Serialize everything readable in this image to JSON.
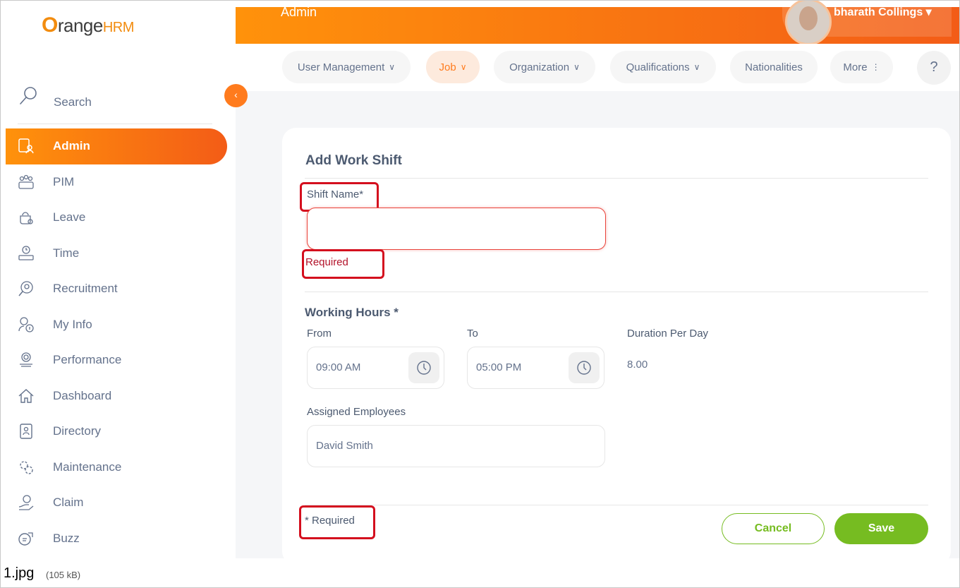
{
  "app": {
    "logo_orange": "O",
    "logo_text": "range",
    "logo_hrm": "HRM"
  },
  "sidebar": {
    "search_label": "Search",
    "items": [
      {
        "label": "Admin",
        "icon": "admin-icon"
      },
      {
        "label": "PIM",
        "icon": "pim-icon"
      },
      {
        "label": "Leave",
        "icon": "leave-icon"
      },
      {
        "label": "Time",
        "icon": "time-icon"
      },
      {
        "label": "Recruitment",
        "icon": "recruitment-icon"
      },
      {
        "label": "My Info",
        "icon": "my-info-icon"
      },
      {
        "label": "Performance",
        "icon": "performance-icon"
      },
      {
        "label": "Dashboard",
        "icon": "dashboard-icon"
      },
      {
        "label": "Directory",
        "icon": "directory-icon"
      },
      {
        "label": "Maintenance",
        "icon": "maintenance-icon"
      },
      {
        "label": "Claim",
        "icon": "claim-icon"
      },
      {
        "label": "Buzz",
        "icon": "buzz-icon"
      }
    ]
  },
  "header": {
    "title": "Admin",
    "user_name": "bharath Collings ▾"
  },
  "tabs": [
    {
      "label": "User Management",
      "chevron": "∨"
    },
    {
      "label": "Job",
      "chevron": "∨"
    },
    {
      "label": "Organization",
      "chevron": "∨"
    },
    {
      "label": "Qualifications",
      "chevron": "∨"
    },
    {
      "label": "Nationalities",
      "chevron": ""
    },
    {
      "label": "More",
      "chevron": "⋮"
    }
  ],
  "help_label": "?",
  "form": {
    "title": "Add Work Shift",
    "shift_name_label": "Shift Name*",
    "shift_name_value": "",
    "shift_name_error": "Required",
    "working_hours_label": "Working Hours *",
    "from_label": "From",
    "from_value": "09:00 AM",
    "to_label": "To",
    "to_value": "05:00 PM",
    "duration_label": "Duration Per Day",
    "duration_value": "8.00",
    "assigned_label": "Assigned Employees",
    "assigned_value": "David Smith",
    "required_note": "* Required",
    "cancel_label": "Cancel",
    "save_label": "Save"
  },
  "footer": {
    "filename": "1.jpg",
    "filesize": "(105 kB)"
  },
  "colors": {
    "accent": "#ff7b1d",
    "green": "#76bc21",
    "error": "#b3132a",
    "annotation": "#d40f1e"
  }
}
